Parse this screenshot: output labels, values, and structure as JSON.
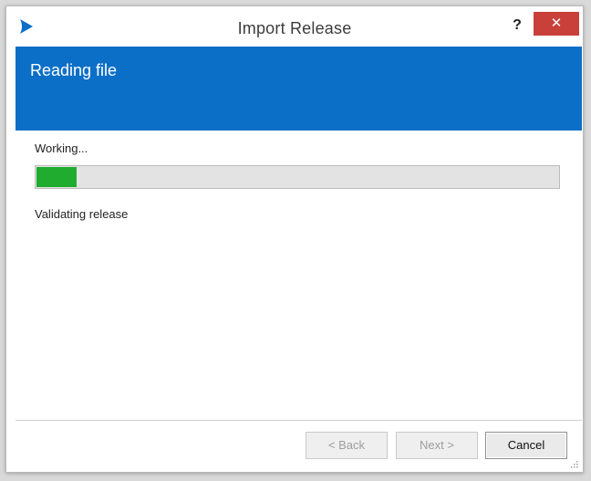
{
  "window": {
    "title": "Import Release",
    "help_label": "?",
    "close_label": "✕",
    "app_icon": "app-logo-icon"
  },
  "banner": {
    "title": "Reading file",
    "color": "#0b6fc7"
  },
  "content": {
    "working_label": "Working...",
    "progress_fraction": 0.077,
    "progress_color": "#1fac2f",
    "status_text": "Validating release"
  },
  "footer": {
    "back_label": "< Back",
    "next_label": "Next >",
    "cancel_label": "Cancel"
  }
}
